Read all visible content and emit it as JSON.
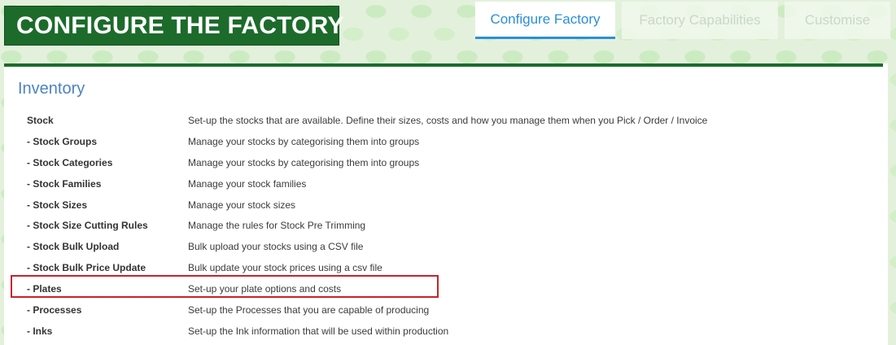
{
  "header": {
    "title": "CONFIGURE THE FACTORY"
  },
  "tabs": [
    {
      "label": "Configure Factory",
      "active": true
    },
    {
      "label": "Factory Capabilities",
      "active": false
    },
    {
      "label": "Customise",
      "active": false
    }
  ],
  "section": {
    "title": "Inventory"
  },
  "rows": [
    {
      "label": "Stock",
      "desc": "Set-up the stocks that are available. Define their sizes, costs and how you manage them when you Pick / Order / Invoice"
    },
    {
      "label": "- Stock Groups",
      "desc": "Manage your stocks by categorising them into groups"
    },
    {
      "label": "- Stock Categories",
      "desc": "Manage your stocks by categorising them into groups"
    },
    {
      "label": "- Stock Families",
      "desc": "Manage your stock families"
    },
    {
      "label": "- Stock Sizes",
      "desc": "Manage your stock sizes"
    },
    {
      "label": "- Stock Size Cutting Rules",
      "desc": "Manage the rules for Stock Pre Trimming"
    },
    {
      "label": "- Stock Bulk Upload",
      "desc": "Bulk upload your stocks using a CSV file"
    },
    {
      "label": "- Stock Bulk Price Update",
      "desc": "Bulk update your stock prices using a csv file"
    },
    {
      "label": "- Plates",
      "desc": "Set-up your plate options and costs",
      "highlighted": true
    },
    {
      "label": "- Processes",
      "desc": "Set-up the Processes that you are capable of producing"
    },
    {
      "label": "- Inks",
      "desc": "Set-up the Ink information that will be used within production"
    }
  ],
  "colors": {
    "brand_green": "#1c6b2b",
    "tab_active": "#2a8fd8",
    "section_title": "#4b83c4",
    "highlight": "#c8232c"
  }
}
